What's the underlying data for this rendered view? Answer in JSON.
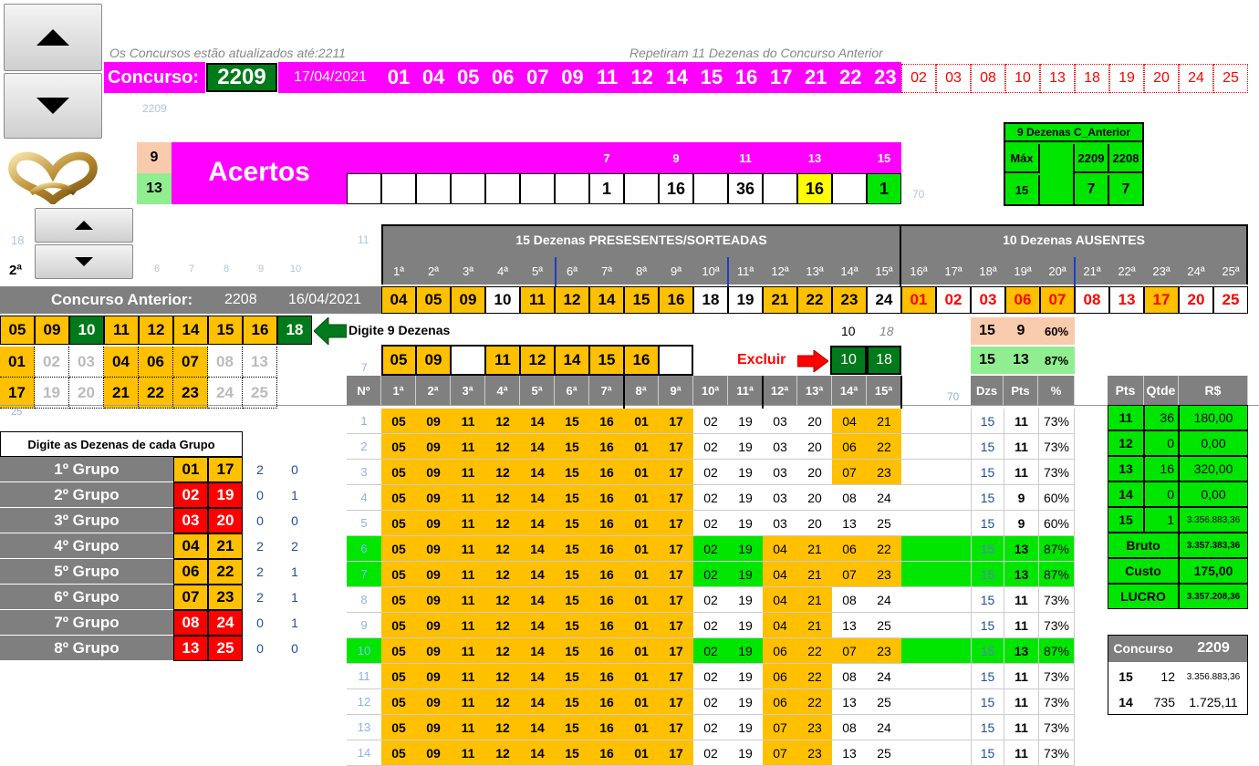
{
  "top": {
    "status_left": "Os Concursos estão atualizados até:2211",
    "status_right": "Repetiram 11 Dezenas do Concurso Anterior",
    "concurso_label": "Concurso:",
    "concurso_num": "2209",
    "date": "17/04/2021",
    "drawn": [
      "01",
      "04",
      "05",
      "06",
      "07",
      "09",
      "11",
      "12",
      "14",
      "15",
      "16",
      "17",
      "21",
      "22",
      "23"
    ],
    "absent": [
      "02",
      "03",
      "08",
      "10",
      "13",
      "18",
      "19",
      "20",
      "24",
      "25"
    ],
    "small_2209": "2209"
  },
  "acertos": {
    "left_top": "9",
    "left_bottom": "13",
    "label": "Acertos",
    "heads": [
      "7",
      "9",
      "11",
      "13",
      "15"
    ],
    "values": [
      "",
      "",
      "",
      "",
      "",
      "",
      "",
      "1",
      "",
      "16",
      "",
      "36",
      "",
      "16",
      "",
      "1"
    ],
    "side_70": "70"
  },
  "cant": {
    "title": "9 Dezenas C_Anterior",
    "max": "Máx",
    "h1": "2209",
    "h2": "2208",
    "v0": "15",
    "v1": "7",
    "v2": "7"
  },
  "small_nav": {
    "label_18": "18",
    "label_2a": "2ª",
    "label_11": "11",
    "nums": [
      "6",
      "7",
      "8",
      "9",
      "10"
    ]
  },
  "main_header": {
    "present_title": "15 Dezenas PRESESENTES/SORTEADAS",
    "absent_title": "10 Dezenas AUSENTES",
    "ordinals": [
      "1ª",
      "2ª",
      "3ª",
      "4ª",
      "5ª",
      "6ª",
      "7ª",
      "8ª",
      "9ª",
      "10ª",
      "11ª",
      "12ª",
      "13ª",
      "14ª",
      "15ª",
      "16ª",
      "17ª",
      "18ª",
      "19ª",
      "20ª",
      "21ª",
      "22ª",
      "23ª",
      "24ª",
      "25ª"
    ],
    "values": [
      "04",
      "05",
      "09",
      "10",
      "11",
      "12",
      "14",
      "15",
      "16",
      "18",
      "19",
      "21",
      "22",
      "23",
      "24",
      "01",
      "02",
      "03",
      "06",
      "07",
      "08",
      "13",
      "17",
      "20",
      "25"
    ]
  },
  "anterior": {
    "label": "Concurso Anterior:",
    "num": "2208",
    "date": "16/04/2021"
  },
  "left_nine": [
    "05",
    "09",
    "10",
    "11",
    "12",
    "14",
    "15",
    "16",
    "18"
  ],
  "left_grid": [
    [
      "01",
      "02",
      "03",
      "04",
      "06",
      "07",
      "08",
      "13"
    ],
    [
      "17",
      "19",
      "20",
      "21",
      "22",
      "23",
      "24",
      "25"
    ]
  ],
  "digite": {
    "label": "Digite 9 Dezenas",
    "num_10": "10",
    "num_18": "18",
    "seven": "7",
    "entries": [
      "05",
      "09",
      "",
      "11",
      "12",
      "14",
      "15",
      "16",
      ""
    ],
    "excluir": "Excluir",
    "exc_a": "10",
    "exc_b": "18",
    "small_25": "25",
    "small_70": "70"
  },
  "summary_top": [
    {
      "a": "15",
      "b": "9",
      "p": "60%"
    },
    {
      "a": "15",
      "b": "13",
      "p": "87%"
    }
  ],
  "groups": {
    "title": "Digite as Dezenas de cada Grupo",
    "rows": [
      {
        "name": "1º Grupo",
        "a": "01",
        "b": "17",
        "x": "2",
        "y": "0"
      },
      {
        "name": "2º Grupo",
        "a": "02",
        "b": "19",
        "x": "0",
        "y": "1"
      },
      {
        "name": "3º Grupo",
        "a": "03",
        "b": "20",
        "x": "0",
        "y": "0"
      },
      {
        "name": "4º Grupo",
        "a": "04",
        "b": "21",
        "x": "2",
        "y": "2"
      },
      {
        "name": "5º Grupo",
        "a": "06",
        "b": "22",
        "x": "2",
        "y": "1"
      },
      {
        "name": "6º Grupo",
        "a": "07",
        "b": "23",
        "x": "2",
        "y": "1"
      },
      {
        "name": "7º Grupo",
        "a": "08",
        "b": "24",
        "x": "0",
        "y": "1"
      },
      {
        "name": "8º Grupo",
        "a": "13",
        "b": "25",
        "x": "0",
        "y": "0"
      }
    ]
  },
  "table": {
    "headers": [
      "Nº",
      "1ª",
      "2ª",
      "3ª",
      "4ª",
      "5ª",
      "6ª",
      "7ª",
      "8ª",
      "9ª",
      "10ª",
      "11ª",
      "12ª",
      "13ª",
      "14ª",
      "15ª",
      "",
      "Dzs",
      "Pts",
      "%"
    ],
    "rows": [
      {
        "n": "1",
        "v": [
          "05",
          "09",
          "11",
          "12",
          "14",
          "15",
          "16",
          "01",
          "17",
          "02",
          "19",
          "03",
          "20",
          "04",
          "21"
        ],
        "dzs": "15",
        "pts": "11",
        "pct": "73%"
      },
      {
        "n": "2",
        "v": [
          "05",
          "09",
          "11",
          "12",
          "14",
          "15",
          "16",
          "01",
          "17",
          "02",
          "19",
          "03",
          "20",
          "06",
          "22"
        ],
        "dzs": "15",
        "pts": "11",
        "pct": "73%"
      },
      {
        "n": "3",
        "v": [
          "05",
          "09",
          "11",
          "12",
          "14",
          "15",
          "16",
          "01",
          "17",
          "02",
          "19",
          "03",
          "20",
          "07",
          "23"
        ],
        "dzs": "15",
        "pts": "11",
        "pct": "73%"
      },
      {
        "n": "4",
        "v": [
          "05",
          "09",
          "11",
          "12",
          "14",
          "15",
          "16",
          "01",
          "17",
          "02",
          "19",
          "03",
          "20",
          "08",
          "24"
        ],
        "dzs": "15",
        "pts": "9",
        "pct": "60%"
      },
      {
        "n": "5",
        "v": [
          "05",
          "09",
          "11",
          "12",
          "14",
          "15",
          "16",
          "01",
          "17",
          "02",
          "19",
          "03",
          "20",
          "13",
          "25"
        ],
        "dzs": "15",
        "pts": "9",
        "pct": "60%"
      },
      {
        "n": "6",
        "v": [
          "05",
          "09",
          "11",
          "12",
          "14",
          "15",
          "16",
          "01",
          "17",
          "02",
          "19",
          "04",
          "21",
          "06",
          "22"
        ],
        "dzs": "15",
        "pts": "13",
        "pct": "87%"
      },
      {
        "n": "7",
        "v": [
          "05",
          "09",
          "11",
          "12",
          "14",
          "15",
          "16",
          "01",
          "17",
          "02",
          "19",
          "04",
          "21",
          "07",
          "23"
        ],
        "dzs": "15",
        "pts": "13",
        "pct": "87%"
      },
      {
        "n": "8",
        "v": [
          "05",
          "09",
          "11",
          "12",
          "14",
          "15",
          "16",
          "01",
          "17",
          "02",
          "19",
          "04",
          "21",
          "08",
          "24"
        ],
        "dzs": "15",
        "pts": "11",
        "pct": "73%"
      },
      {
        "n": "9",
        "v": [
          "05",
          "09",
          "11",
          "12",
          "14",
          "15",
          "16",
          "01",
          "17",
          "02",
          "19",
          "04",
          "21",
          "13",
          "25"
        ],
        "dzs": "15",
        "pts": "11",
        "pct": "73%"
      },
      {
        "n": "10",
        "v": [
          "05",
          "09",
          "11",
          "12",
          "14",
          "15",
          "16",
          "01",
          "17",
          "02",
          "19",
          "06",
          "22",
          "07",
          "23"
        ],
        "dzs": "15",
        "pts": "13",
        "pct": "87%"
      },
      {
        "n": "11",
        "v": [
          "05",
          "09",
          "11",
          "12",
          "14",
          "15",
          "16",
          "01",
          "17",
          "02",
          "19",
          "06",
          "22",
          "08",
          "24"
        ],
        "dzs": "15",
        "pts": "11",
        "pct": "73%"
      },
      {
        "n": "12",
        "v": [
          "05",
          "09",
          "11",
          "12",
          "14",
          "15",
          "16",
          "01",
          "17",
          "02",
          "19",
          "06",
          "22",
          "13",
          "25"
        ],
        "dzs": "15",
        "pts": "11",
        "pct": "73%"
      },
      {
        "n": "13",
        "v": [
          "05",
          "09",
          "11",
          "12",
          "14",
          "15",
          "16",
          "01",
          "17",
          "02",
          "19",
          "07",
          "23",
          "08",
          "24"
        ],
        "dzs": "15",
        "pts": "11",
        "pct": "73%"
      },
      {
        "n": "14",
        "v": [
          "05",
          "09",
          "11",
          "12",
          "14",
          "15",
          "16",
          "01",
          "17",
          "02",
          "19",
          "07",
          "23",
          "13",
          "25"
        ],
        "dzs": "15",
        "pts": "11",
        "pct": "73%"
      }
    ]
  },
  "prize": {
    "headers": [
      "Pts",
      "Qtde",
      "R$"
    ],
    "rows": [
      {
        "p": "11",
        "q": "36",
        "r": "180,00"
      },
      {
        "p": "12",
        "q": "0",
        "r": "0,00"
      },
      {
        "p": "13",
        "q": "16",
        "r": "320,00"
      },
      {
        "p": "14",
        "q": "0",
        "r": "0,00"
      },
      {
        "p": "15",
        "q": "1",
        "r": "3.356.883,36"
      }
    ],
    "bruto_label": "Bruto",
    "bruto": "3.357.383,36",
    "custo_label": "Custo",
    "custo": "175,00",
    "lucro_label": "LUCRO",
    "lucro": "3.357.208,36"
  },
  "concurso_box": {
    "label": "Concurso",
    "num": "2209",
    "rows": [
      {
        "a": "15",
        "b": "12",
        "c": "3.356.883,36"
      },
      {
        "a": "14",
        "b": "735",
        "c": "1.725,11"
      }
    ]
  }
}
